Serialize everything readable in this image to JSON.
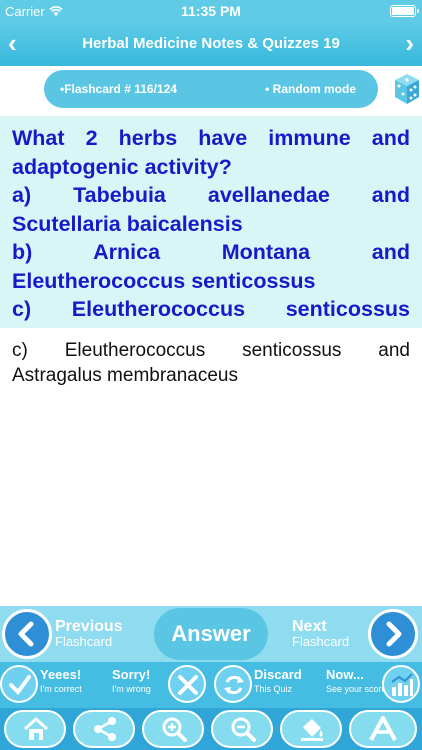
{
  "status_bar": {
    "carrier": "Carrier",
    "time": "11:35 PM"
  },
  "nav": {
    "title": "Herbal Medicine Notes & Quizzes 19",
    "back_icon": "chevron-left-icon",
    "forward_icon": "chevron-right-icon"
  },
  "info": {
    "card_number": "•Flashcard #  116/124",
    "mode": "• Random mode",
    "dice_icon": "dice-icon"
  },
  "question": {
    "lines": [
      "What 2 herbs have immune and",
      "adaptogenic activity?",
      "a) Tabebuia avellanedae and",
      "Scutellaria baicalensis",
      "b) Arnica Montana and",
      "Eleutherococcus senticossus",
      "c) Eleutherococcus senticossus"
    ]
  },
  "answer": {
    "lines": [
      "c) Eleutherococcus senticossus and",
      "Astragalus membranaceus"
    ]
  },
  "row1": {
    "previous": {
      "line1": "Previous",
      "line2": "Flashcard"
    },
    "answer": "Answer",
    "next": {
      "line1": "Next",
      "line2": "Flashcard"
    }
  },
  "row2": {
    "correct": {
      "line1": "Yeees!",
      "line2": "I'm correct"
    },
    "wrong": {
      "line1": "Sorry!",
      "line2": "I'm wrong"
    },
    "discard": {
      "line1": "Discard",
      "line2": "This Quiz"
    },
    "score": {
      "line1": "Now...",
      "line2": "See your score"
    }
  },
  "colors": {
    "accent": "#5ac6e4",
    "question_text": "#1a19c9",
    "question_bg": "#d9f6f6",
    "nav_dark": "#2e8fd6"
  }
}
